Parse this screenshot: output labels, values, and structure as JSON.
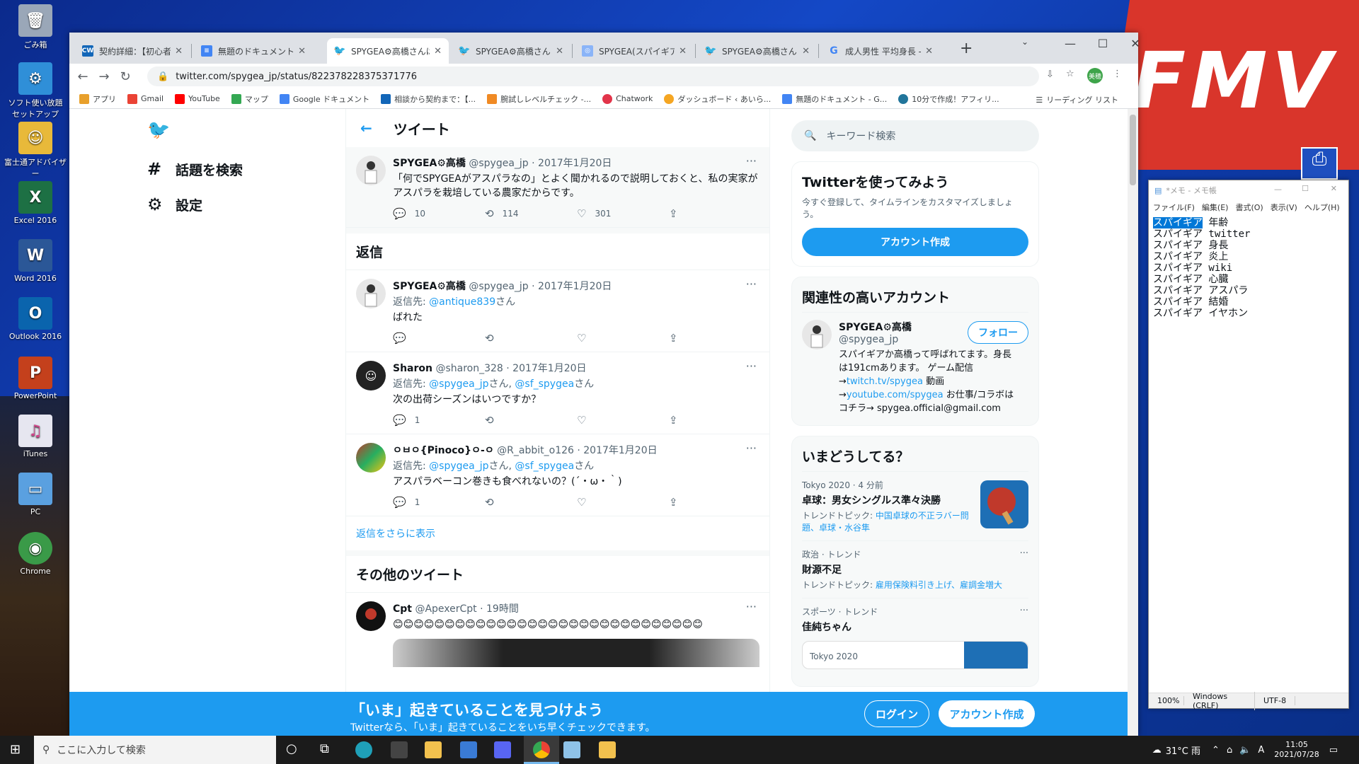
{
  "desktop": {
    "brand": "FMV",
    "icons": [
      "ごみ箱",
      "ソフト使い放題 セットアップ",
      "富士通アドバイザー",
      "Excel 2016",
      "Word 2016",
      "Outlook 2016",
      "PowerPoint",
      "iTunes",
      "PC",
      "Chrome"
    ]
  },
  "browser": {
    "tabs": [
      {
        "title": "契約詳細：【初心者・主",
        "fav": "CW"
      },
      {
        "title": "無題のドキュメント - Goo",
        "fav": "doc"
      },
      {
        "title": "SPYGEA⚙高橋さんは",
        "fav": "twitter"
      },
      {
        "title": "SPYGEA⚙高橋さん (@",
        "fav": "twitter"
      },
      {
        "title": "SPYGEA(スパイギア)の身",
        "fav": "site"
      },
      {
        "title": "SPYGEA⚙高橋さんは",
        "fav": "twitter"
      },
      {
        "title": "成人男性 平均身長 - G",
        "fav": "google"
      }
    ],
    "url": "twitter.com/spygea_jp/status/822378228375371776",
    "profile": "美穂",
    "bookmarks": [
      "アプリ",
      "Gmail",
      "YouTube",
      "マップ",
      "Google ドキュメント",
      "相談から契約まで：【...",
      "腕試しレベルチェック -...",
      "Chatwork",
      "ダッシュボード ‹ あいら...",
      "無題のドキュメント - G...",
      "10分で作成！アフィリ..."
    ],
    "reading_list": "リーディング リスト"
  },
  "nav": {
    "explore": "話題を検索",
    "settings": "設定"
  },
  "feed": {
    "header": "ツイート",
    "main": {
      "name": "SPYGEA⚙高橋",
      "handle": "@spygea_jp · 2017年1月20日",
      "text": "「何でSPYGEAがアスパラなの」とよく聞かれるので説明しておくと、私の実家がアスパラを栽培している農家だからです。",
      "replies": "10",
      "retweets": "114",
      "likes": "301"
    },
    "replies_header": "返信",
    "replies": [
      {
        "name": "SPYGEA⚙高橋",
        "handle": "@spygea_jp · 2017年1月20日",
        "reply_label": "返信先:",
        "reply_to": "@antique839",
        "reply_tail": "さん",
        "text": "ばれた",
        "count": ""
      },
      {
        "name": "Sharon",
        "handle": "@sharon_328 · 2017年1月20日",
        "reply_label": "返信先:",
        "reply_to": "@spygea_jp",
        "reply_mid": "さん, ",
        "reply_to2": "@sf_spygea",
        "reply_tail": "さん",
        "text": "次の出荷シーズンはいつですか？",
        "count": "1"
      },
      {
        "name": "ㅇㅂㅇ{Pinoco}ㅇ-ㅇ",
        "handle": "@R_abbit_o126 · 2017年1月20日",
        "reply_label": "返信先:",
        "reply_to": "@spygea_jp",
        "reply_mid": "さん, ",
        "reply_to2": "@sf_spygea",
        "reply_tail": "さん",
        "text": "アスパラベーコン巻きも食べれないの？(´・ω・｀)",
        "count": "1"
      }
    ],
    "more_replies": "返信をさらに表示",
    "other_header": "その他のツイート",
    "other": {
      "name": "Cpt",
      "handle": "@ApexerCpt · 19時間",
      "text": "😊😊😊😊😊😊😊😊😊😊😊😊😊😊😊😊😊😊😊😊😊😊😊😊😊😊😊😊😊😊"
    }
  },
  "right": {
    "search_placeholder": "キーワード検索",
    "join": {
      "title": "Twitterを使ってみよう",
      "sub": "今すぐ登録して、タイムラインをカスタマイズしましょう。",
      "button": "アカウント作成"
    },
    "related": {
      "title": "関連性の高いアカウント",
      "name": "SPYGEA⚙高橋",
      "handle": "@spygea_jp",
      "follow": "フォロー",
      "bio1": "スパイギアか高橋って呼ばれてます。身長は191cmあります。 ゲーム配信→",
      "link1": "twitch.tv/spygea",
      "bio2": " 動画→",
      "link2": "youtube.com/spygea",
      "bio3": " お仕事/コラボはコチラ→ spygea.official@gmail.com"
    },
    "trends": {
      "title": "いまどうしてる？",
      "items": [
        {
          "meta": "Tokyo 2020 · 4 分前",
          "name": "卓球：男女シングルス準々決勝",
          "rel_label": "トレンドトピック: ",
          "rel": "中国卓球の不正ラバー問題、卓球・水谷隼"
        },
        {
          "meta": "政治 · トレンド",
          "name": "財源不足",
          "rel_label": "トレンドトピック: ",
          "rel": "雇用保険料引き上げ、雇調金増大"
        },
        {
          "meta": "スポーツ · トレンド",
          "name": "佳純ちゃん",
          "rel_label": "",
          "rel": ""
        }
      ],
      "card_label": "Tokyo 2020"
    }
  },
  "banner": {
    "title": "「いま」起きていることを見つけよう",
    "sub": "Twitterなら、「いま」起きていることをいち早くチェックできます。",
    "login": "ログイン",
    "signup": "アカウント作成"
  },
  "notepad": {
    "title": "*メモ - メモ帳",
    "menu": [
      "ファイル(F)",
      "編集(E)",
      "書式(O)",
      "表示(V)",
      "ヘルプ(H)"
    ],
    "first_sel": "スパイギア",
    "first_rest": " 年齢",
    "lines": "\nスパイギア twitter\nスパイギア 身長\nスパイギア 炎上\nスパイギア wiki\nスパイギア 心臓\nスパイギア アスパラ\nスパイギア 結婚\nスパイギア イヤホン",
    "status": [
      "100%",
      "Windows (CRLF)",
      "UTF-8"
    ]
  },
  "taskbar": {
    "search": "ここに入力して検索",
    "weather": "31°C 雨",
    "time": "11:05",
    "date": "2021/07/28"
  }
}
